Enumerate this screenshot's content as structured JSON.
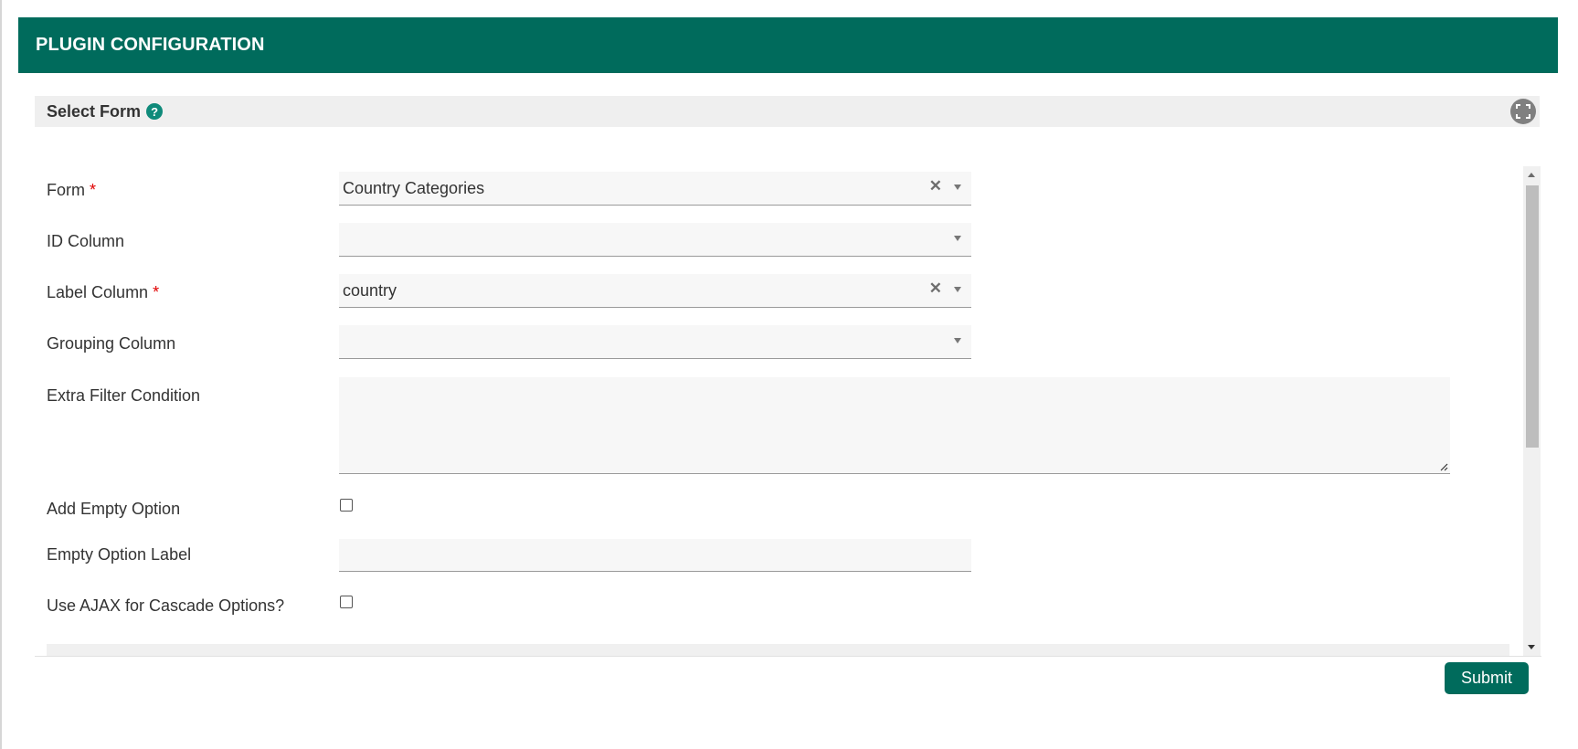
{
  "header": {
    "title": "PLUGIN CONFIGURATION"
  },
  "section": {
    "title": "Select Form",
    "help_icon": "question-circle-icon",
    "expand_icon": "fullscreen-icon"
  },
  "fields": {
    "form": {
      "label": "Form",
      "required_mark": "*",
      "value": "Country Categories",
      "clear_glyph": "✕"
    },
    "id_column": {
      "label": "ID Column",
      "value": ""
    },
    "label_column": {
      "label": "Label Column",
      "required_mark": "*",
      "value": "country",
      "clear_glyph": "✕"
    },
    "grouping_column": {
      "label": "Grouping Column",
      "value": ""
    },
    "extra_filter": {
      "label": "Extra Filter Condition",
      "value": ""
    },
    "add_empty_option": {
      "label": "Add Empty Option",
      "checked": false
    },
    "empty_option_label": {
      "label": "Empty Option Label",
      "value": ""
    },
    "use_ajax": {
      "label": "Use AJAX for Cascade Options?",
      "checked": false
    }
  },
  "actions": {
    "submit_label": "Submit"
  },
  "colors": {
    "primary": "#006b5c",
    "accent": "#0f8a7a",
    "required": "#e00000"
  }
}
